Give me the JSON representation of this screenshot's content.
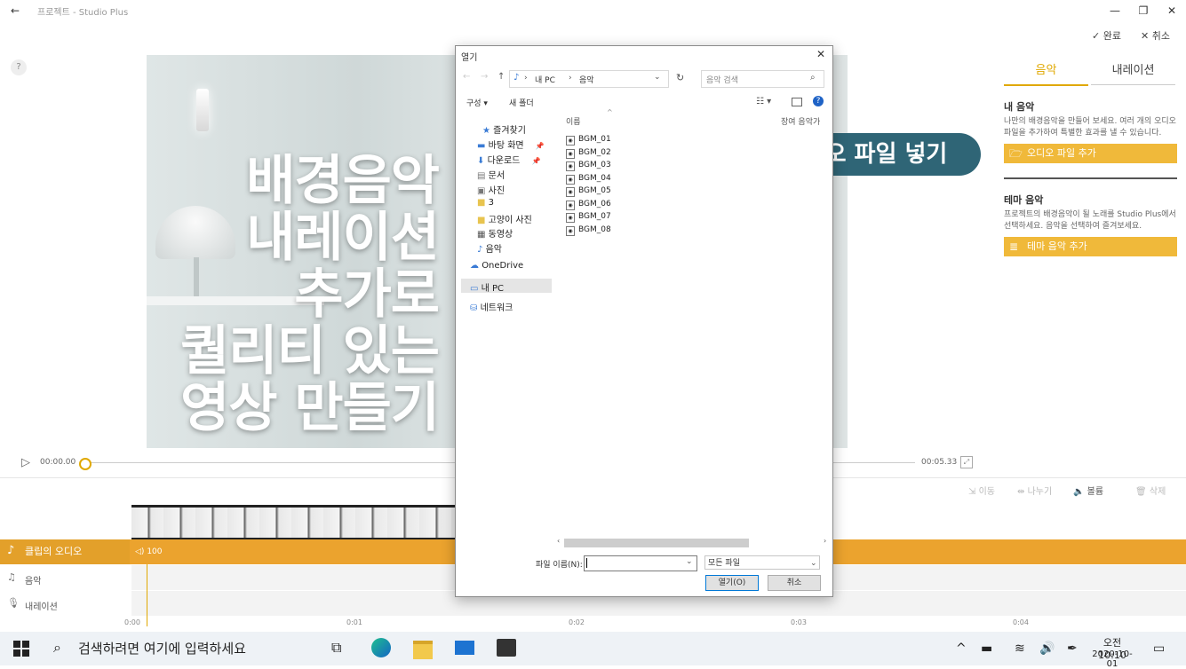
{
  "window": {
    "title": "프로젝트 - Studio Plus",
    "back_icon": "←",
    "min_icon": "—",
    "restore_icon": "❐",
    "close_icon": "✕",
    "help_icon": "?"
  },
  "header_actions": {
    "done_label": "완료",
    "cancel_label": "취소"
  },
  "preview": {
    "lines": [
      "배경음악",
      "내레이션",
      "추가로",
      "퀄리티 있는",
      "영상 만들기"
    ]
  },
  "callout": {
    "text": "● 오디오 파일 넣기"
  },
  "right_panel": {
    "tabs": [
      "음악",
      "내레이션"
    ],
    "my_music_title": "내 음악",
    "my_music_desc": "나만의 배경음악을 만들어 보세요. 여러 개의 오디오 파일을 추가하여 특별한 효과를 낼 수 있습니다.",
    "add_audio_label": "오디오 파일 추가",
    "theme_title": "테마 음악",
    "theme_desc": "프로젝트의 배경음악이 될 노래를 Studio Plus에서 선택하세요. 음악을 선택하여 즐겨보세요.",
    "add_theme_label": "테마 음악 추가"
  },
  "playback": {
    "current_time": "00:00.00",
    "total_time": "00:05.33"
  },
  "toolbar": {
    "move": "이동",
    "split": "나누기",
    "volume": "볼륨",
    "delete": "삭제"
  },
  "timeline": {
    "clip_audio_label": "클립의 오디오",
    "clip_volume": "100",
    "music_label": "음악",
    "narration_label": "내레이션",
    "ruler": [
      "0:00",
      "0:01",
      "0:02",
      "0:03",
      "0:04"
    ]
  },
  "dialog": {
    "title": "열기",
    "path": [
      "내 PC",
      "음악"
    ],
    "search_placeholder": "음악 검색",
    "organize_label": "구성 ▾",
    "new_folder_label": "새 폴더",
    "col_name": "이름",
    "col_right": "장여 음악가",
    "nav": [
      "즐겨찾기",
      "바탕 화면",
      "다운로드",
      "문서",
      "사진",
      "3",
      "고양이 사진",
      "동영상",
      "음악",
      "OneDrive",
      "내 PC",
      "네트워크"
    ],
    "files": [
      "BGM_01",
      "BGM_02",
      "BGM_03",
      "BGM_04",
      "BGM_05",
      "BGM_06",
      "BGM_07",
      "BGM_08"
    ],
    "filename_label": "파일 이름(N):",
    "filename_value": "",
    "filetype_value": "모든 파일",
    "open_label": "열기(O)",
    "cancel_label": "취소"
  },
  "taskbar": {
    "search_placeholder": "검색하려면 여기에 입력하세요",
    "time": "오전 10:10",
    "date": "2020-10-01"
  }
}
